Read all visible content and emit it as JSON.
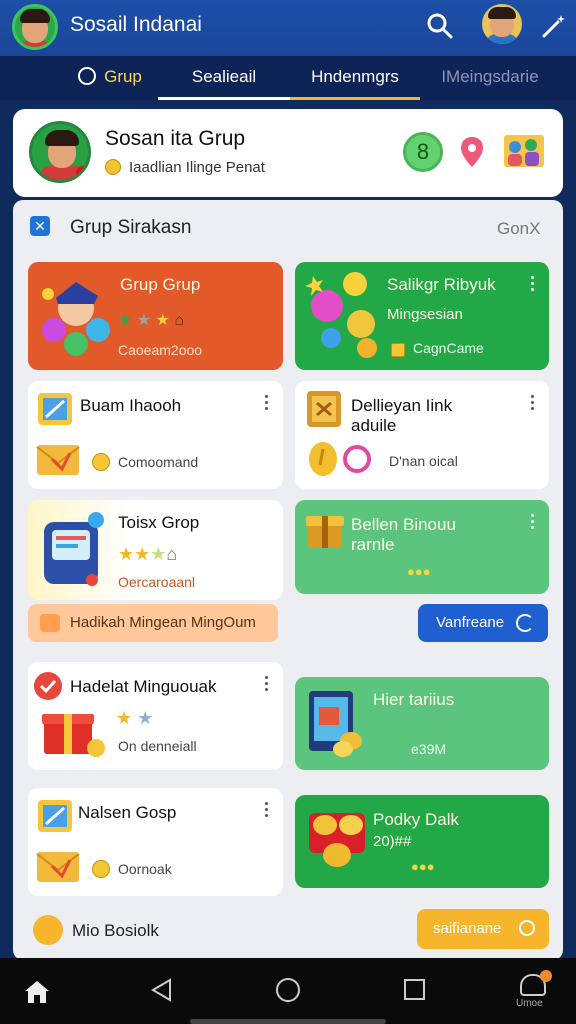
{
  "header": {
    "title": "Sosail Indanai"
  },
  "tabs": [
    {
      "label": "Grup"
    },
    {
      "label": "Sealieail"
    },
    {
      "label": "Hndenmgrs"
    },
    {
      "label": "IMeingsdarie"
    }
  ],
  "profile": {
    "name": "Sosan ita Grup",
    "subtitle": "Iaadlian Ilinge Penat",
    "level": "8"
  },
  "panel": {
    "title": "Grup Sirakasn",
    "close_label": "GonX"
  },
  "cards": [
    {
      "title": "Grup Grup",
      "sub": "Caoeam2ooo"
    },
    {
      "title": "Salikgr Ribyuk",
      "title2": "Mingsesian",
      "sub": "CagnCame"
    },
    {
      "title": "Buam Ihaooh",
      "sub": "Comoomand"
    },
    {
      "title": "Dellieyan Iink",
      "title2": "aduile",
      "sub": "D'nan oical"
    },
    {
      "title": "Toisx Grop",
      "sub": "Oercaroaanl"
    },
    {
      "title": "Bellen Binouu",
      "title2": "rarnle"
    },
    {
      "title": "Hadelat Minguouak",
      "sub": "On denneiall"
    },
    {
      "title": "Hier tariius",
      "sub": "e39M"
    },
    {
      "title": "Nalsen Gosp",
      "sub": "Oornoak"
    },
    {
      "title": "Podky Dalk",
      "title2": "20)##"
    }
  ],
  "banner": {
    "text": "Hadikah Mingean MingOum",
    "button": "Vanfreane"
  },
  "footer": {
    "left_text": "Mio Bosiolk",
    "button": "saifianane"
  },
  "nav": {
    "right_label": "Umoe"
  },
  "colors": {
    "primary": "#1d4fa8",
    "orange": "#e25a2a",
    "green": "#23a848",
    "light_green": "#5bc47d",
    "gold": "#f6b52b"
  }
}
